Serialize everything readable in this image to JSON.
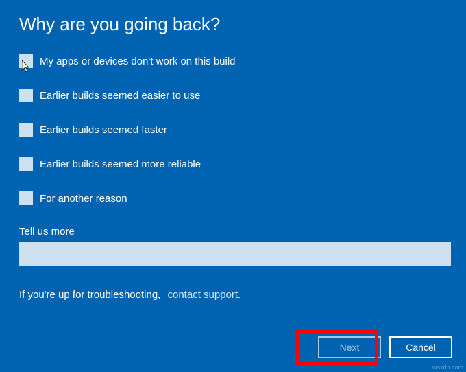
{
  "title": "Why are you going back?",
  "options": [
    {
      "label": "My apps or devices don't work on this build"
    },
    {
      "label": "Earlier builds seemed easier to use"
    },
    {
      "label": "Earlier builds seemed faster"
    },
    {
      "label": "Earlier builds seemed more reliable"
    },
    {
      "label": "For another reason"
    }
  ],
  "tell_more_label": "Tell us more",
  "tell_more_value": "",
  "support_prefix": "If you're up for troubleshooting,",
  "support_link": "contact support.",
  "buttons": {
    "next": "Next",
    "cancel": "Cancel"
  },
  "attribution": "wsxdn.com"
}
